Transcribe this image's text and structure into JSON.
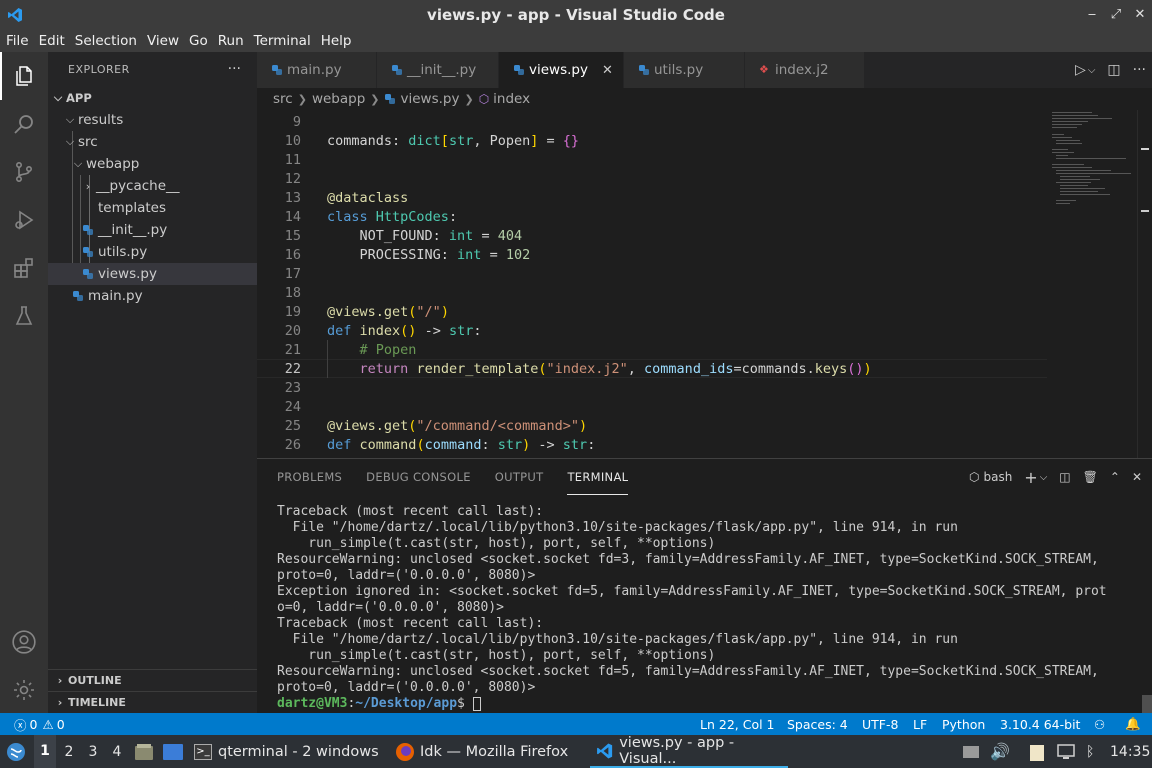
{
  "window": {
    "title": "views.py - app - Visual Studio Code",
    "controls": [
      "‒",
      "⤢",
      "✕"
    ]
  },
  "menu": [
    "File",
    "Edit",
    "Selection",
    "View",
    "Go",
    "Run",
    "Terminal",
    "Help"
  ],
  "explorer": {
    "header": "EXPLORER",
    "more": "···",
    "root": "APP",
    "tree": [
      {
        "label": "results",
        "depth": 1,
        "type": "folder-collapsed-open"
      },
      {
        "label": "src",
        "depth": 1,
        "type": "folder-open"
      },
      {
        "label": "webapp",
        "depth": 2,
        "type": "folder-open"
      },
      {
        "label": "__pycache__",
        "depth": 3,
        "type": "folder-closed"
      },
      {
        "label": "templates",
        "depth": 3,
        "type": "folder-none"
      },
      {
        "label": "__init__.py",
        "depth": 3,
        "type": "py"
      },
      {
        "label": "utils.py",
        "depth": 3,
        "type": "py"
      },
      {
        "label": "views.py",
        "depth": 3,
        "type": "py",
        "selected": true
      },
      {
        "label": "main.py",
        "depth": 2,
        "type": "py"
      }
    ],
    "outline": "OUTLINE",
    "timeline": "TIMELINE"
  },
  "tabs": [
    {
      "label": "main.py",
      "icon": "python-icon"
    },
    {
      "label": "__init__.py",
      "icon": "python-icon"
    },
    {
      "label": "views.py",
      "icon": "python-icon",
      "active": true,
      "close": "✕"
    },
    {
      "label": "utils.py",
      "icon": "python-icon"
    },
    {
      "label": "index.j2",
      "icon": "jinja-icon"
    }
  ],
  "breadcrumb": [
    "src",
    "webapp",
    "views.py",
    "index"
  ],
  "editor": {
    "current_line": 22,
    "lines": [
      {
        "n": "9",
        "html": ""
      },
      {
        "n": "10",
        "html": "commands: <span class=\"ty\">dict</span><span class=\"br\">[</span><span class=\"ty\">str</span>, Popen<span class=\"br\">]</span> = <span class=\"br2\">{}</span>"
      },
      {
        "n": "11",
        "html": ""
      },
      {
        "n": "12",
        "html": ""
      },
      {
        "n": "13",
        "html": "<span class=\"fn\">@dataclass</span>"
      },
      {
        "n": "14",
        "html": "<span class=\"kw\">class</span> <span class=\"ty\">HttpCodes</span>:"
      },
      {
        "n": "15",
        "html": "    NOT_FOUND: <span class=\"ty\">int</span> = <span class=\"nu\">404</span>"
      },
      {
        "n": "16",
        "html": "    PROCESSING: <span class=\"ty\">int</span> = <span class=\"nu\">102</span>"
      },
      {
        "n": "17",
        "html": ""
      },
      {
        "n": "18",
        "html": ""
      },
      {
        "n": "19",
        "html": "<span class=\"fn\">@views.get</span><span class=\"br\">(</span><span class=\"st\">\"/\"</span><span class=\"br\">)</span>"
      },
      {
        "n": "20",
        "html": "<span class=\"kw\">def</span> <span class=\"fn\">index</span><span class=\"br\">()</span> -&gt; <span class=\"ty\">str</span>:"
      },
      {
        "n": "21",
        "html": "    <span class=\"cm\"># Popen</span>"
      },
      {
        "n": "22",
        "html": "    <span class=\"kw2\">return</span> <span class=\"fn\">render_template</span><span class=\"br\">(</span><span class=\"st\">\"index.j2\"</span>, <span class=\"va\">command_ids</span>=commands.<span class=\"fn\">keys</span><span class=\"br2\">()</span><span class=\"br\">)</span>"
      },
      {
        "n": "23",
        "html": ""
      },
      {
        "n": "24",
        "html": ""
      },
      {
        "n": "25",
        "html": "<span class=\"fn\">@views.get</span><span class=\"br\">(</span><span class=\"st\">\"/command/&lt;command&gt;\"</span><span class=\"br\">)</span>"
      },
      {
        "n": "26",
        "html": "<span class=\"kw\">def</span> <span class=\"fn\">command</span><span class=\"br\">(</span><span class=\"va\">command</span>: <span class=\"ty\">str</span><span class=\"br\">)</span> -&gt; <span class=\"ty\">str</span>:"
      }
    ]
  },
  "panel": {
    "tabs": [
      "PROBLEMS",
      "DEBUG CONSOLE",
      "OUTPUT",
      "TERMINAL"
    ],
    "active_tab": "TERMINAL",
    "shell": "bash",
    "terminal_lines": [
      "Traceback (most recent call last):",
      "  File \"/home/dartz/.local/lib/python3.10/site-packages/flask/app.py\", line 914, in run",
      "    run_simple(t.cast(str, host), port, self, **options)",
      "ResourceWarning: unclosed <socket.socket fd=3, family=AddressFamily.AF_INET, type=SocketKind.SOCK_STREAM,",
      "proto=0, laddr=('0.0.0.0', 8080)>",
      "Exception ignored in: <socket.socket fd=5, family=AddressFamily.AF_INET, type=SocketKind.SOCK_STREAM, prot",
      "o=0, laddr=('0.0.0.0', 8080)>",
      "Traceback (most recent call last):",
      "  File \"/home/dartz/.local/lib/python3.10/site-packages/flask/app.py\", line 914, in run",
      "    run_simple(t.cast(str, host), port, self, **options)",
      "ResourceWarning: unclosed <socket.socket fd=5, family=AddressFamily.AF_INET, type=SocketKind.SOCK_STREAM,",
      "proto=0, laddr=('0.0.0.0', 8080)>"
    ],
    "prompt": {
      "user": "dartz@VM3",
      "sep": ":",
      "path": "~/Desktop/app",
      "symbol": "$ "
    }
  },
  "statusbar": {
    "errors": "0",
    "warnings": "0",
    "position": "Ln 22, Col 1",
    "spaces": "Spaces: 4",
    "encoding": "UTF-8",
    "eol": "LF",
    "language": "Python",
    "interpreter": "3.10.4 64-bit"
  },
  "taskbar": {
    "workspaces": [
      "1",
      "2",
      "3",
      "4"
    ],
    "tasks": [
      {
        "label": "qterminal - 2 windows",
        "icon": "terminal-icon"
      },
      {
        "label": "Idk — Mozilla Firefox",
        "icon": "firefox-icon"
      },
      {
        "label": "views.py - app - Visual...",
        "icon": "vscode-icon",
        "active": true
      }
    ],
    "clock": "14:35"
  },
  "colors": {
    "accent": "#007acc",
    "taskbar": "#2c3035",
    "editor_bg": "#1e1e1e"
  }
}
